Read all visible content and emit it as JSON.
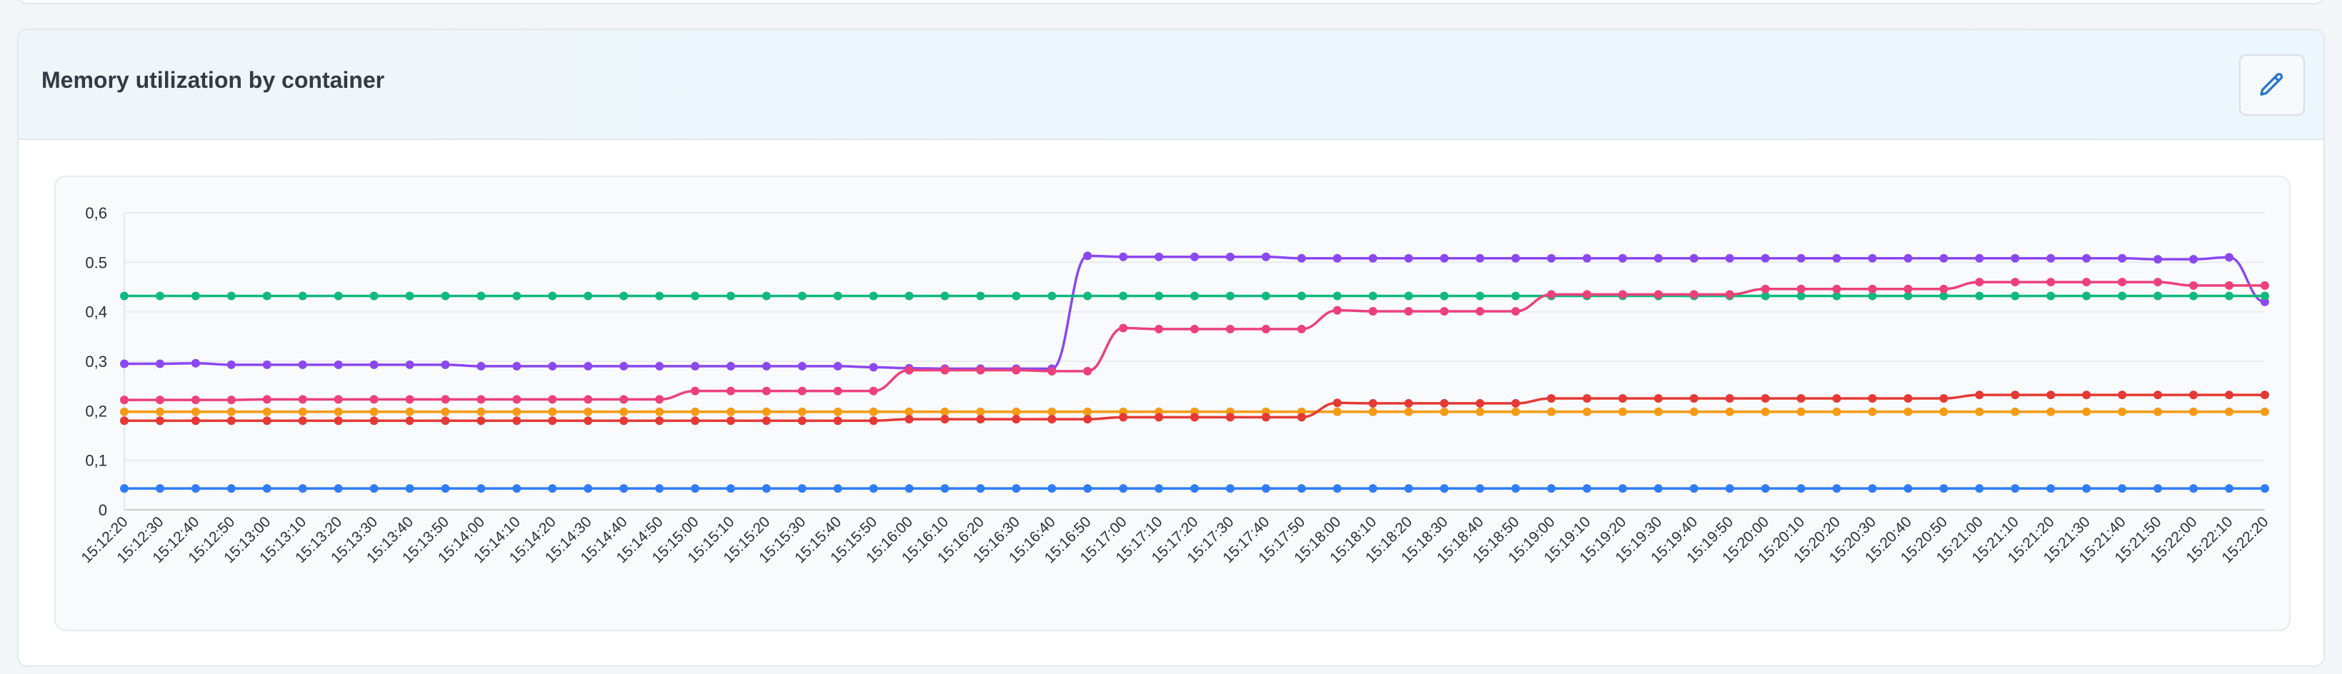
{
  "panel": {
    "title": "Memory utilization by container",
    "edit_icon": "pencil-icon"
  },
  "chart_data": {
    "type": "line",
    "title": "Memory utilization by container",
    "xlabel": "",
    "ylabel": "",
    "ylim": [
      0,
      0.6
    ],
    "y_ticks": [
      "0",
      "0,1",
      "0,2",
      "0,3",
      "0,4",
      "0.5",
      "0,6"
    ],
    "grid": "horizontal",
    "legend": "none",
    "x": [
      "15:12:20",
      "15:12:30",
      "15:12:40",
      "15:12:50",
      "15:13:00",
      "15:13:10",
      "15:13:20",
      "15:13:30",
      "15:13:40",
      "15:13:50",
      "15:14:00",
      "15:14:10",
      "15:14:20",
      "15:14:30",
      "15:14:40",
      "15:14:50",
      "15:15:00",
      "15:15:10",
      "15:15:20",
      "15:15:30",
      "15:15:40",
      "15:15:50",
      "15:16:00",
      "15:16:10",
      "15:16:20",
      "15:16:30",
      "15:16:40",
      "15:16:50",
      "15:17:00",
      "15:17:10",
      "15:17:20",
      "15:17:30",
      "15:17:40",
      "15:17:50",
      "15:18:00",
      "15:18:10",
      "15:18:20",
      "15:18:30",
      "15:18:40",
      "15:18:50",
      "15:19:00",
      "15:19:10",
      "15:19:20",
      "15:19:30",
      "15:19:40",
      "15:19:50",
      "15:20:00",
      "15:20:10",
      "15:20:20",
      "15:20:30",
      "15:20:40",
      "15:20:50",
      "15:21:00",
      "15:21:10",
      "15:21:20",
      "15:21:30",
      "15:21:40",
      "15:21:50",
      "15:22:00",
      "15:22:10",
      "15:22:20"
    ],
    "series": [
      {
        "color": "#8b47f0",
        "values": [
          0.295,
          0.295,
          0.296,
          0.293,
          0.293,
          0.293,
          0.293,
          0.293,
          0.293,
          0.293,
          0.29,
          0.29,
          0.29,
          0.29,
          0.29,
          0.29,
          0.29,
          0.29,
          0.29,
          0.29,
          0.29,
          0.288,
          0.286,
          0.285,
          0.285,
          0.285,
          0.285,
          0.513,
          0.511,
          0.511,
          0.511,
          0.511,
          0.511,
          0.508,
          0.508,
          0.508,
          0.508,
          0.508,
          0.508,
          0.508,
          0.508,
          0.508,
          0.508,
          0.508,
          0.508,
          0.508,
          0.508,
          0.508,
          0.508,
          0.508,
          0.508,
          0.508,
          0.508,
          0.508,
          0.508,
          0.508,
          0.508,
          0.506,
          0.506,
          0.51,
          0.42
        ]
      },
      {
        "color": "#10b97c",
        "values": [
          0.432,
          0.432,
          0.432,
          0.432,
          0.432,
          0.432,
          0.432,
          0.432,
          0.432,
          0.432,
          0.432,
          0.432,
          0.432,
          0.432,
          0.432,
          0.432,
          0.432,
          0.432,
          0.432,
          0.432,
          0.432,
          0.432,
          0.432,
          0.432,
          0.432,
          0.432,
          0.432,
          0.432,
          0.432,
          0.432,
          0.432,
          0.432,
          0.432,
          0.432,
          0.432,
          0.432,
          0.432,
          0.432,
          0.432,
          0.432,
          0.432,
          0.432,
          0.432,
          0.432,
          0.432,
          0.432,
          0.432,
          0.432,
          0.432,
          0.432,
          0.432,
          0.432,
          0.432,
          0.432,
          0.432,
          0.432,
          0.432,
          0.432,
          0.432,
          0.432,
          0.432
        ]
      },
      {
        "color": "#ec407a",
        "values": [
          0.222,
          0.222,
          0.222,
          0.222,
          0.223,
          0.223,
          0.223,
          0.223,
          0.223,
          0.223,
          0.223,
          0.223,
          0.223,
          0.223,
          0.223,
          0.223,
          0.24,
          0.24,
          0.24,
          0.24,
          0.24,
          0.24,
          0.282,
          0.282,
          0.282,
          0.282,
          0.28,
          0.28,
          0.367,
          0.365,
          0.365,
          0.365,
          0.365,
          0.365,
          0.403,
          0.401,
          0.401,
          0.401,
          0.401,
          0.401,
          0.435,
          0.435,
          0.435,
          0.435,
          0.435,
          0.435,
          0.446,
          0.446,
          0.446,
          0.446,
          0.446,
          0.446,
          0.46,
          0.46,
          0.46,
          0.46,
          0.46,
          0.46,
          0.453,
          0.453,
          0.453
        ]
      },
      {
        "color": "#f59b16",
        "values": [
          0.198,
          0.198,
          0.198,
          0.198,
          0.198,
          0.198,
          0.198,
          0.198,
          0.198,
          0.198,
          0.198,
          0.198,
          0.198,
          0.198,
          0.198,
          0.198,
          0.198,
          0.198,
          0.198,
          0.198,
          0.198,
          0.198,
          0.198,
          0.198,
          0.198,
          0.198,
          0.198,
          0.198,
          0.198,
          0.198,
          0.198,
          0.198,
          0.198,
          0.198,
          0.198,
          0.198,
          0.198,
          0.198,
          0.198,
          0.198,
          0.198,
          0.198,
          0.198,
          0.198,
          0.198,
          0.198,
          0.198,
          0.198,
          0.198,
          0.198,
          0.198,
          0.198,
          0.198,
          0.198,
          0.198,
          0.198,
          0.198,
          0.198,
          0.198,
          0.198,
          0.198
        ]
      },
      {
        "color": "#e53935",
        "values": [
          0.18,
          0.18,
          0.18,
          0.18,
          0.18,
          0.18,
          0.18,
          0.18,
          0.18,
          0.18,
          0.18,
          0.18,
          0.18,
          0.18,
          0.18,
          0.18,
          0.18,
          0.18,
          0.18,
          0.18,
          0.18,
          0.18,
          0.183,
          0.183,
          0.183,
          0.183,
          0.183,
          0.183,
          0.187,
          0.187,
          0.187,
          0.187,
          0.187,
          0.187,
          0.216,
          0.215,
          0.215,
          0.215,
          0.215,
          0.215,
          0.225,
          0.225,
          0.225,
          0.225,
          0.225,
          0.225,
          0.225,
          0.225,
          0.225,
          0.225,
          0.225,
          0.225,
          0.232,
          0.232,
          0.232,
          0.232,
          0.232,
          0.232,
          0.232,
          0.232,
          0.232
        ]
      },
      {
        "color": "#2f7df6",
        "values": [
          0.043,
          0.043,
          0.043,
          0.043,
          0.043,
          0.043,
          0.043,
          0.043,
          0.043,
          0.043,
          0.043,
          0.043,
          0.043,
          0.043,
          0.043,
          0.043,
          0.043,
          0.043,
          0.043,
          0.043,
          0.043,
          0.043,
          0.043,
          0.043,
          0.043,
          0.043,
          0.043,
          0.043,
          0.043,
          0.043,
          0.043,
          0.043,
          0.043,
          0.043,
          0.043,
          0.043,
          0.043,
          0.043,
          0.043,
          0.043,
          0.043,
          0.043,
          0.043,
          0.043,
          0.043,
          0.043,
          0.043,
          0.043,
          0.043,
          0.043,
          0.043,
          0.043,
          0.043,
          0.043,
          0.043,
          0.043,
          0.043,
          0.043,
          0.043,
          0.043,
          0.043
        ]
      }
    ]
  }
}
